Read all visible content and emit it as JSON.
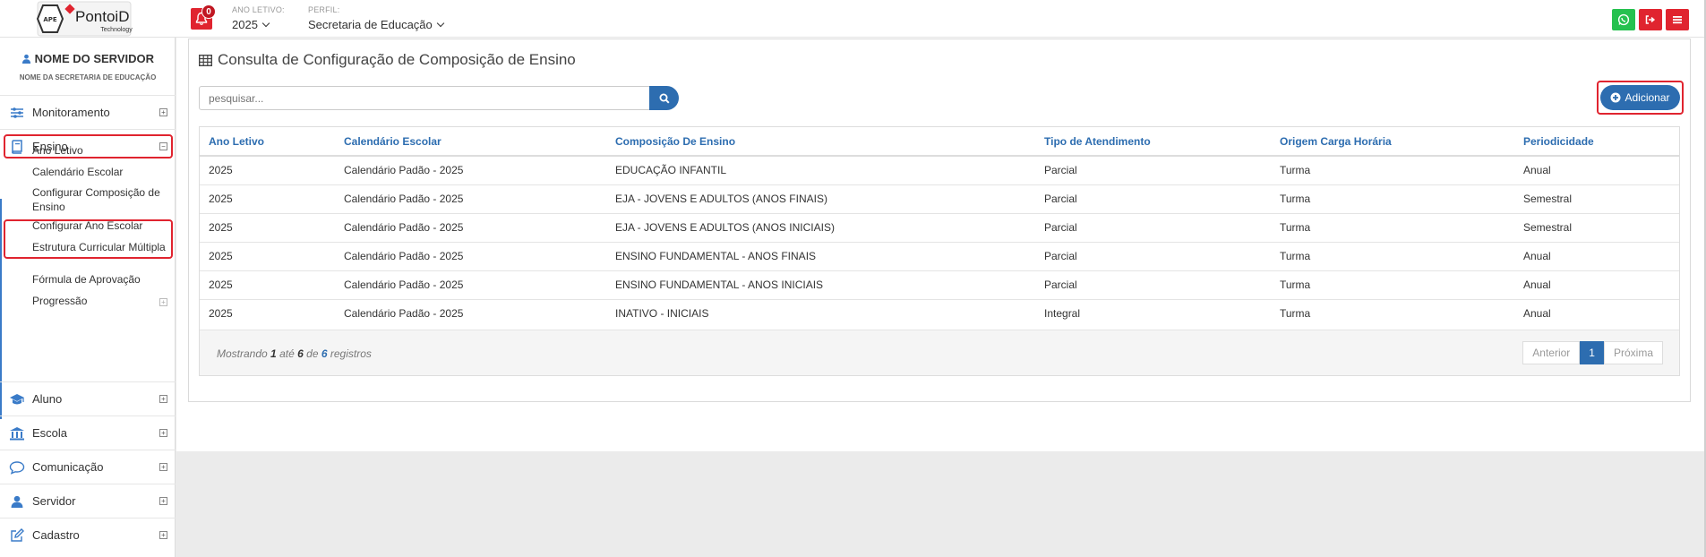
{
  "header": {
    "logo_text": "PontoiD",
    "logo_sub": "Technology",
    "logo_badge": "APE",
    "notification_count": "0",
    "ano_letivo_label": "ANO LETIVO:",
    "ano_letivo_value": "2025",
    "perfil_label": "PERFIL:",
    "perfil_value": "Secretaria de Educação"
  },
  "sidebar": {
    "user_name": "NOME DO SERVIDOR",
    "org_name": "NOME DA SECRETARIA DE EDUCAÇÃO",
    "items": [
      {
        "label": "Monitoramento",
        "toggle": "+"
      },
      {
        "label": "Ensino",
        "toggle": "−"
      },
      {
        "label": "Aluno",
        "toggle": "+"
      },
      {
        "label": "Escola",
        "toggle": "+"
      },
      {
        "label": "Comunicação",
        "toggle": "+"
      },
      {
        "label": "Servidor",
        "toggle": "+"
      },
      {
        "label": "Cadastro",
        "toggle": "+"
      }
    ],
    "ensino_sub": [
      {
        "label": "Ano Letivo"
      },
      {
        "label": "Calendário Escolar"
      },
      {
        "label": "Configurar Composição de Ensino"
      },
      {
        "label": "Configurar Ano Escolar"
      },
      {
        "label": "Estrutura Curricular Múltipla"
      },
      {
        "label": "Fórmula de Aprovação"
      },
      {
        "label": "Progressão"
      }
    ]
  },
  "main": {
    "title": "Consulta de Configuração de Composição de Ensino",
    "search_placeholder": "pesquisar...",
    "add_label": "Adicionar",
    "columns": [
      "Ano Letivo",
      "Calendário Escolar",
      "Composição De Ensino",
      "Tipo de Atendimento",
      "Origem Carga Horária",
      "Periodicidade"
    ],
    "rows": [
      [
        "2025",
        "Calendário Padão - 2025",
        "EDUCAÇÃO INFANTIL",
        "Parcial",
        "Turma",
        "Anual"
      ],
      [
        "2025",
        "Calendário Padão - 2025",
        "EJA - JOVENS E ADULTOS (ANOS FINAIS)",
        "Parcial",
        "Turma",
        "Semestral"
      ],
      [
        "2025",
        "Calendário Padão - 2025",
        "EJA - JOVENS E ADULTOS (ANOS INICIAIS)",
        "Parcial",
        "Turma",
        "Semestral"
      ],
      [
        "2025",
        "Calendário Padão - 2025",
        "ENSINO FUNDAMENTAL - ANOS FINAIS",
        "Parcial",
        "Turma",
        "Anual"
      ],
      [
        "2025",
        "Calendário Padão - 2025",
        "ENSINO FUNDAMENTAL - ANOS INICIAIS",
        "Parcial",
        "Turma",
        "Anual"
      ],
      [
        "2025",
        "Calendário Padão - 2025",
        "INATIVO - INICIAIS",
        "Integral",
        "Turma",
        "Anual"
      ]
    ],
    "info": {
      "prefix": "Mostrando",
      "from": "1",
      "mid1": "até",
      "to": "6",
      "mid2": "de",
      "total": "6",
      "suffix": "registros"
    },
    "pager": {
      "prev": "Anterior",
      "current": "1",
      "next": "Próxima"
    }
  },
  "colors": {
    "accent": "#2d6db0",
    "alert": "#e0242f",
    "whatsapp": "#25c14f"
  }
}
